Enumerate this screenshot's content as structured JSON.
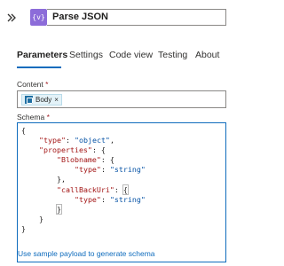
{
  "header": {
    "title": "Parse JSON",
    "connector_icon": "{v}",
    "connector_color": "#8c6cd9"
  },
  "tabs": [
    {
      "label": "Parameters",
      "active": true
    },
    {
      "label": "Settings",
      "active": false
    },
    {
      "label": "Code view",
      "active": false
    },
    {
      "label": "Testing",
      "active": false
    },
    {
      "label": "About",
      "active": false
    }
  ],
  "content": {
    "label": "Content",
    "required_mark": "*",
    "token_label": "Body",
    "token_remove": "×"
  },
  "schema": {
    "label": "Schema",
    "required_mark": "*",
    "lines": {
      "l1": "{",
      "type_key": "\"type\"",
      "type_val": "\"object\"",
      "props_key": "\"properties\"",
      "blob_key": "\"Blobname\"",
      "blob_type_key": "\"type\"",
      "blob_type_val": "\"string\"",
      "cb_key": "\"callBackUri\"",
      "cb_type_key": "\"type\"",
      "cb_type_val": "\"string\""
    }
  },
  "sample_link": "Use sample payload to generate schema",
  "accent_color": "#0f6cbd"
}
